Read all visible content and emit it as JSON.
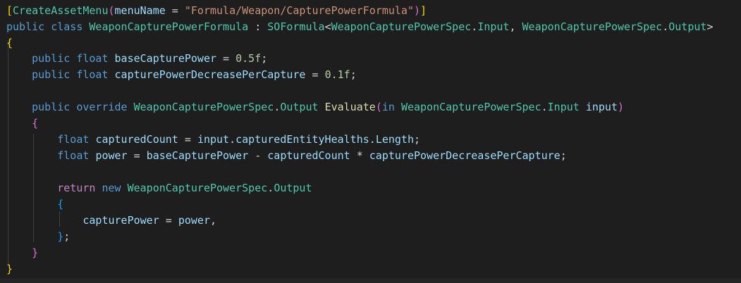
{
  "code_lines": [
    [
      [
        "b1",
        "["
      ],
      [
        "type",
        "CreateAssetMenu"
      ],
      [
        "b2",
        "("
      ],
      [
        "var",
        "menuName"
      ],
      [
        "op",
        " = "
      ],
      [
        "str",
        "\"Formula/Weapon/CapturePowerFormula\""
      ],
      [
        "b2",
        ")"
      ],
      [
        "b1",
        "]"
      ]
    ],
    [
      [
        "kw",
        "public"
      ],
      [
        "op",
        " "
      ],
      [
        "kw",
        "class"
      ],
      [
        "op",
        " "
      ],
      [
        "type",
        "WeaponCapturePowerFormula"
      ],
      [
        "op",
        " : "
      ],
      [
        "type",
        "SOFormula"
      ],
      [
        "op",
        "<"
      ],
      [
        "type",
        "WeaponCapturePowerSpec"
      ],
      [
        "op",
        "."
      ],
      [
        "type",
        "Input"
      ],
      [
        "op",
        ", "
      ],
      [
        "type",
        "WeaponCapturePowerSpec"
      ],
      [
        "op",
        "."
      ],
      [
        "type",
        "Output"
      ],
      [
        "op",
        ">"
      ]
    ],
    [
      [
        "b1",
        "{"
      ]
    ],
    [
      [
        "op",
        "    "
      ],
      [
        "kw",
        "public"
      ],
      [
        "op",
        " "
      ],
      [
        "kw",
        "float"
      ],
      [
        "op",
        " "
      ],
      [
        "var",
        "baseCapturePower"
      ],
      [
        "op",
        " = "
      ],
      [
        "num",
        "0.5f"
      ],
      [
        "op",
        ";"
      ]
    ],
    [
      [
        "op",
        "    "
      ],
      [
        "kw",
        "public"
      ],
      [
        "op",
        " "
      ],
      [
        "kw",
        "float"
      ],
      [
        "op",
        " "
      ],
      [
        "var",
        "capturePowerDecreasePerCapture"
      ],
      [
        "op",
        " = "
      ],
      [
        "num",
        "0.1f"
      ],
      [
        "op",
        ";"
      ]
    ],
    [],
    [
      [
        "op",
        "    "
      ],
      [
        "kw",
        "public"
      ],
      [
        "op",
        " "
      ],
      [
        "kw",
        "override"
      ],
      [
        "op",
        " "
      ],
      [
        "type",
        "WeaponCapturePowerSpec"
      ],
      [
        "op",
        "."
      ],
      [
        "type",
        "Output"
      ],
      [
        "op",
        " "
      ],
      [
        "fn",
        "Evaluate"
      ],
      [
        "b2",
        "("
      ],
      [
        "kw",
        "in"
      ],
      [
        "op",
        " "
      ],
      [
        "type",
        "WeaponCapturePowerSpec"
      ],
      [
        "op",
        "."
      ],
      [
        "type",
        "Input"
      ],
      [
        "op",
        " "
      ],
      [
        "var",
        "input"
      ],
      [
        "b2",
        ")"
      ]
    ],
    [
      [
        "op",
        "    "
      ],
      [
        "b2",
        "{"
      ]
    ],
    [
      [
        "op",
        "        "
      ],
      [
        "kw",
        "float"
      ],
      [
        "op",
        " "
      ],
      [
        "var",
        "capturedCount"
      ],
      [
        "op",
        " = "
      ],
      [
        "var",
        "input"
      ],
      [
        "op",
        "."
      ],
      [
        "var",
        "capturedEntityHealths"
      ],
      [
        "op",
        "."
      ],
      [
        "var",
        "Length"
      ],
      [
        "op",
        ";"
      ]
    ],
    [
      [
        "op",
        "        "
      ],
      [
        "kw",
        "float"
      ],
      [
        "op",
        " "
      ],
      [
        "var",
        "power"
      ],
      [
        "op",
        " = "
      ],
      [
        "var",
        "baseCapturePower"
      ],
      [
        "op",
        " - "
      ],
      [
        "var",
        "capturedCount"
      ],
      [
        "op",
        " * "
      ],
      [
        "var",
        "capturePowerDecreasePerCapture"
      ],
      [
        "op",
        ";"
      ]
    ],
    [],
    [
      [
        "op",
        "        "
      ],
      [
        "ctl",
        "return"
      ],
      [
        "op",
        " "
      ],
      [
        "kw",
        "new"
      ],
      [
        "op",
        " "
      ],
      [
        "type",
        "WeaponCapturePowerSpec"
      ],
      [
        "op",
        "."
      ],
      [
        "type",
        "Output"
      ]
    ],
    [
      [
        "op",
        "        "
      ],
      [
        "b3",
        "{"
      ]
    ],
    [
      [
        "op",
        "            "
      ],
      [
        "var",
        "capturePower"
      ],
      [
        "op",
        " = "
      ],
      [
        "var",
        "power"
      ],
      [
        "op",
        ","
      ]
    ],
    [
      [
        "op",
        "        "
      ],
      [
        "b3",
        "}"
      ],
      [
        "op",
        ";"
      ]
    ],
    [
      [
        "op",
        "    "
      ],
      [
        "b2",
        "}"
      ]
    ],
    [
      [
        "b1",
        "}"
      ]
    ]
  ]
}
